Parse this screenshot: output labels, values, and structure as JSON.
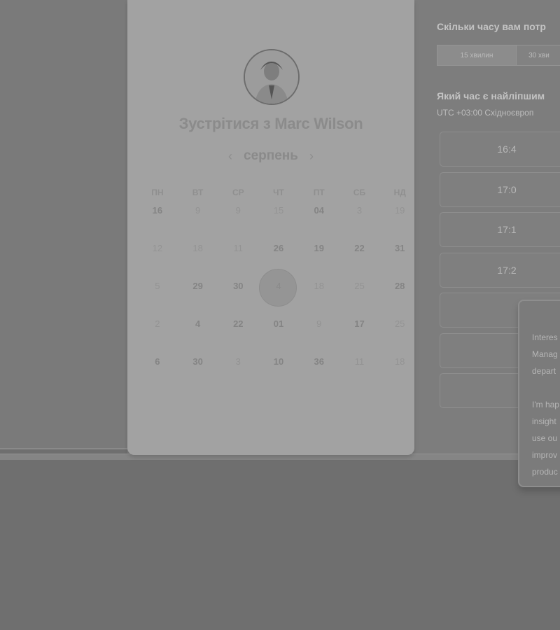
{
  "booking": {
    "title": "Зустрітися з Marc Wilson",
    "month": "серпень",
    "prev_arrow": "‹",
    "next_arrow": "›",
    "weekdays": [
      "ПН",
      "ВТ",
      "СР",
      "ЧТ",
      "ПТ",
      "СБ",
      "НД"
    ],
    "weeks": [
      [
        "16",
        "9",
        "9",
        "15",
        "04",
        "3",
        "19"
      ],
      [
        "12",
        "18",
        "11",
        "26",
        "19",
        "22",
        "31"
      ],
      [
        "5",
        "29",
        "30",
        "4",
        "18",
        "25",
        "28"
      ],
      [
        "2",
        "4",
        "22",
        "01",
        "9",
        "17",
        "25"
      ],
      [
        "6",
        "30",
        "3",
        "10",
        "36",
        "11",
        "18"
      ]
    ],
    "selected_day": "4"
  },
  "sidebar": {
    "duration_question": "Скільки часу вам потр",
    "durations": [
      "15 хвилин",
      "30 хви"
    ],
    "time_question": "Який час є найліпшим",
    "timezone": "UTC +03:00 Східноєвроп",
    "slots": [
      "16:4",
      "17:0",
      "17:1",
      "17:2",
      "",
      "",
      ""
    ]
  },
  "popup": {
    "lines1": [
      "Interes",
      "Manag",
      "depart"
    ],
    "lines2": [
      "I'm hap",
      "insight",
      "use ou",
      "improv",
      "produc"
    ]
  },
  "colors": {
    "overlay": "#6f6f6f",
    "card": "#a2a2a2"
  }
}
